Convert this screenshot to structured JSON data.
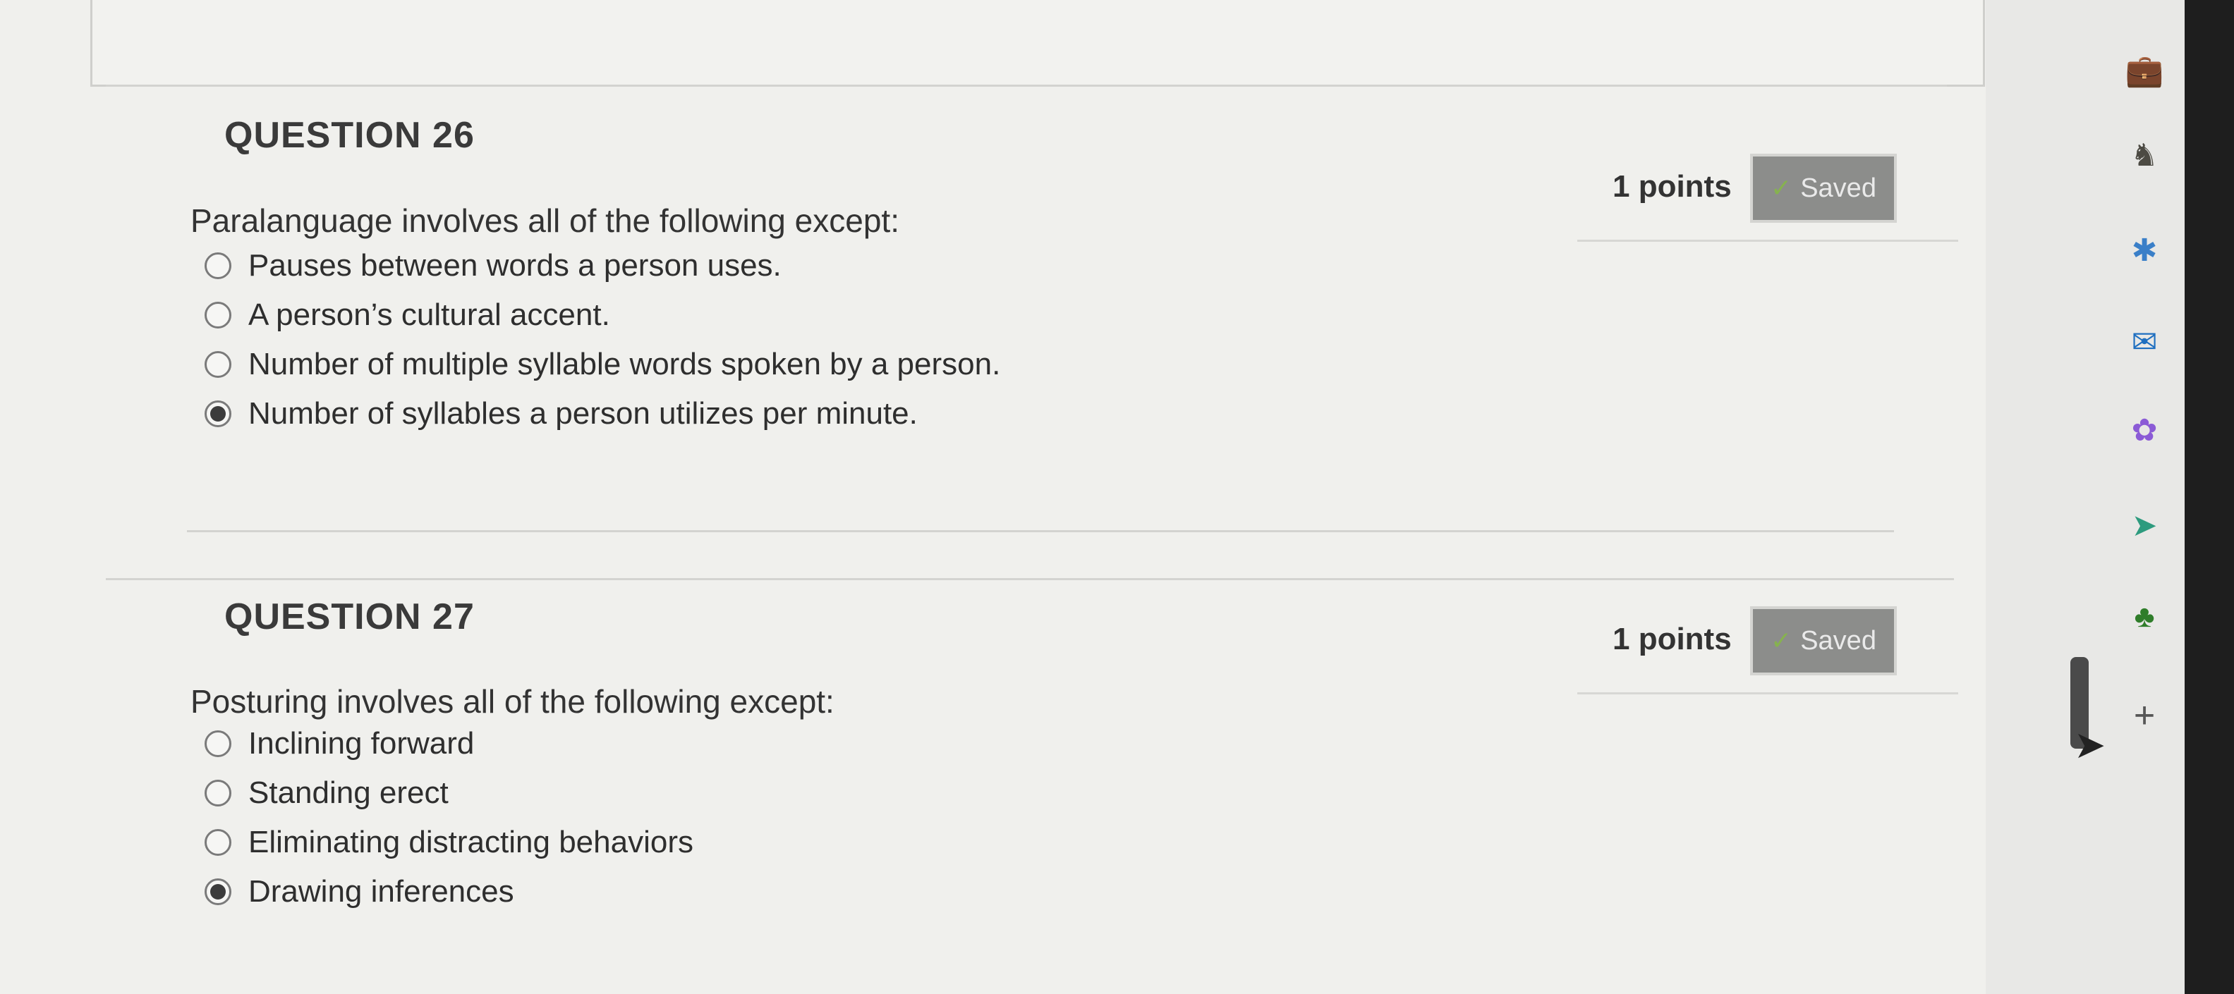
{
  "questions": [
    {
      "title": "QUESTION 26",
      "points": "1 points",
      "saved_label": "Saved",
      "prompt": "Paralanguage involves all of the following except:",
      "options": [
        {
          "label": "Pauses between words a person uses.",
          "selected": false
        },
        {
          "label": "A person’s cultural accent.",
          "selected": false
        },
        {
          "label": "Number of multiple syllable words spoken by a person.",
          "selected": false
        },
        {
          "label": "Number of syllables a person utilizes per minute.",
          "selected": true
        }
      ]
    },
    {
      "title": "QUESTION 27",
      "points": "1 points",
      "saved_label": "Saved",
      "prompt": "Posturing involves all of the following except:",
      "options": [
        {
          "label": "Inclining forward",
          "selected": false
        },
        {
          "label": "Standing erect",
          "selected": false
        },
        {
          "label": "Eliminating distracting behaviors",
          "selected": false
        },
        {
          "label": "Drawing inferences",
          "selected": true
        }
      ]
    }
  ],
  "sidebar": {
    "icons": [
      "briefcase-icon",
      "chess-icon",
      "copilot-icon",
      "outlook-icon",
      "games-icon",
      "send-icon",
      "tree-icon",
      "add-icon"
    ],
    "add_label": "+"
  },
  "colors": {
    "saved_badge": "#8c8d8b",
    "check": "#86b24f"
  }
}
